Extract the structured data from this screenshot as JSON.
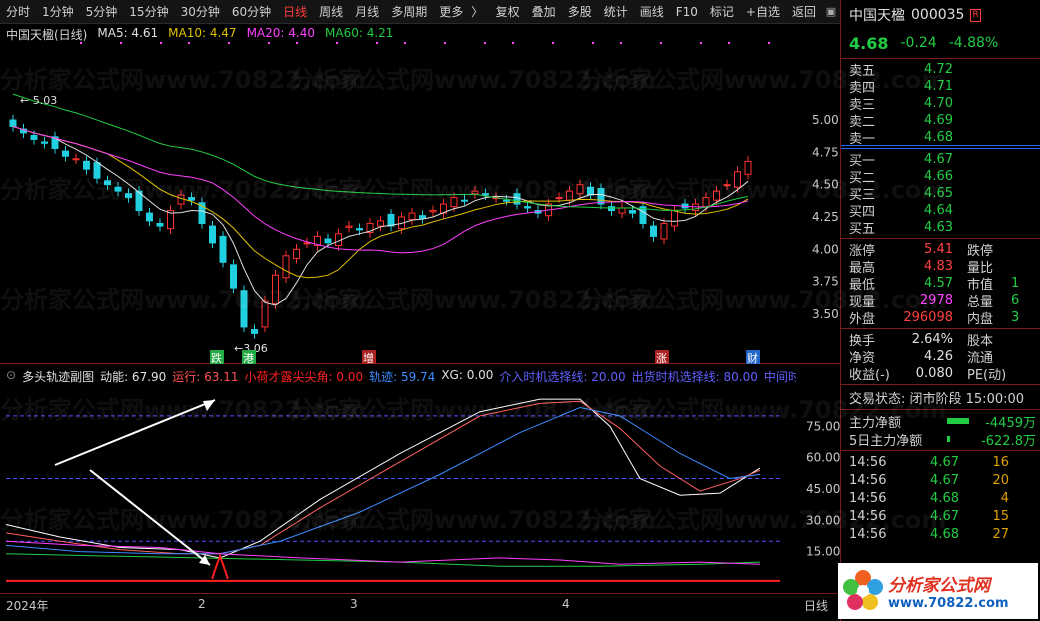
{
  "toolbar": {
    "left": [
      "分时",
      "1分钟",
      "5分钟",
      "15分钟",
      "30分钟",
      "60分钟",
      "日线",
      "周线",
      "月线",
      "多周期",
      "更多"
    ],
    "active": "日线",
    "more_arrow": "〉",
    "right": [
      "复权",
      "叠加",
      "多股",
      "统计",
      "画线",
      "F10",
      "标记",
      "+自选",
      "返回"
    ]
  },
  "main_legend": {
    "stock": "中国天楹(日线)",
    "ma5": "MA5: 4.61",
    "ma10": "MA10: 4.47",
    "ma20": "MA20: 4.40",
    "ma60": "MA60: 4.21"
  },
  "main_axis": [
    "5.00",
    "4.75",
    "4.50",
    "4.25",
    "4.00",
    "3.75",
    "3.50"
  ],
  "annotations": {
    "high": "5.03",
    "low": "3.06"
  },
  "event_tags": [
    {
      "text": "跌",
      "color": "#22aa44"
    },
    {
      "text": "港",
      "color": "#22aa44"
    },
    {
      "text": "增",
      "color": "#aa2222"
    },
    {
      "text": "涨",
      "color": "#aa2222"
    },
    {
      "text": "财",
      "color": "#2266cc"
    }
  ],
  "sub_legend": {
    "name": "多头轨迹副图",
    "items": [
      {
        "text": "动能: 67.90",
        "color": "#e0e0e0"
      },
      {
        "text": "运行: 63.11",
        "color": "#ff5050"
      },
      {
        "text": "小荷才露尖尖角: 0.00",
        "color": "#ff2020"
      },
      {
        "text": "轨迹: 59.74",
        "color": "#3a8cff"
      },
      {
        "text": "XG: 0.00",
        "color": "#e0e0e0"
      },
      {
        "text": "介入时机选择线: 20.00",
        "color": "#6060ff"
      },
      {
        "text": "出货时机选择线: 80.00",
        "color": "#6060ff"
      },
      {
        "text": "中间时机选",
        "color": "#6060ff"
      }
    ]
  },
  "sub_axis": [
    "75.00",
    "60.00",
    "45.00",
    "30.00",
    "15.00"
  ],
  "xaxis": {
    "labels": [
      "2024年",
      "2",
      "3",
      "4"
    ],
    "right": "日线"
  },
  "watermark": "分析家公式网www.70822.com",
  "quote": {
    "name": "中国天楹",
    "code": "000035",
    "badge": "R",
    "last": "4.68",
    "change": "-0.24",
    "pct": "-4.88%",
    "asks": [
      {
        "label": "卖五",
        "price": "4.72"
      },
      {
        "label": "卖四",
        "price": "4.71"
      },
      {
        "label": "卖三",
        "price": "4.70"
      },
      {
        "label": "卖二",
        "price": "4.69"
      },
      {
        "label": "卖一",
        "price": "4.68"
      }
    ],
    "bids": [
      {
        "label": "买一",
        "price": "4.67"
      },
      {
        "label": "买二",
        "price": "4.66"
      },
      {
        "label": "买三",
        "price": "4.65"
      },
      {
        "label": "买四",
        "price": "4.64"
      },
      {
        "label": "买五",
        "price": "4.63"
      }
    ],
    "stats": [
      {
        "l": "涨停",
        "v": "5.41",
        "vc": "red",
        "l2": "跌停",
        "v2": ""
      },
      {
        "l": "最高",
        "v": "4.83",
        "vc": "red",
        "l2": "量比",
        "v2": ""
      },
      {
        "l": "最低",
        "v": "4.57",
        "vc": "green",
        "l2": "市值",
        "v2": "1"
      },
      {
        "l": "现量",
        "v": "2978",
        "vc": "magenta",
        "l2": "总量",
        "v2": "6"
      },
      {
        "l": "外盘",
        "v": "296098",
        "vc": "red",
        "l2": "内盘",
        "v2": "3"
      }
    ],
    "stats2": [
      {
        "l": "换手",
        "v": "2.64%",
        "l2": "股本"
      },
      {
        "l": "净资",
        "v": "4.26",
        "l2": "流通"
      },
      {
        "l": "收益(-)",
        "v": "0.080",
        "l2": "PE(动)"
      }
    ],
    "status": "交易状态: 闭市阶段 15:00:00",
    "flow": [
      {
        "l": "主力净额",
        "v": "-4459万"
      },
      {
        "l": "5日主力净额",
        "v": "-622.8万"
      }
    ],
    "ticks": [
      {
        "t": "14:56",
        "p": "4.67",
        "v": "16"
      },
      {
        "t": "14:56",
        "p": "4.67",
        "v": "20"
      },
      {
        "t": "14:56",
        "p": "4.68",
        "v": "4"
      },
      {
        "t": "14:56",
        "p": "4.67",
        "v": "15"
      },
      {
        "t": "14:56",
        "p": "4.68",
        "v": "27"
      }
    ]
  },
  "logo": {
    "title": "分析家公式网",
    "url": "www.70822.com"
  }
}
